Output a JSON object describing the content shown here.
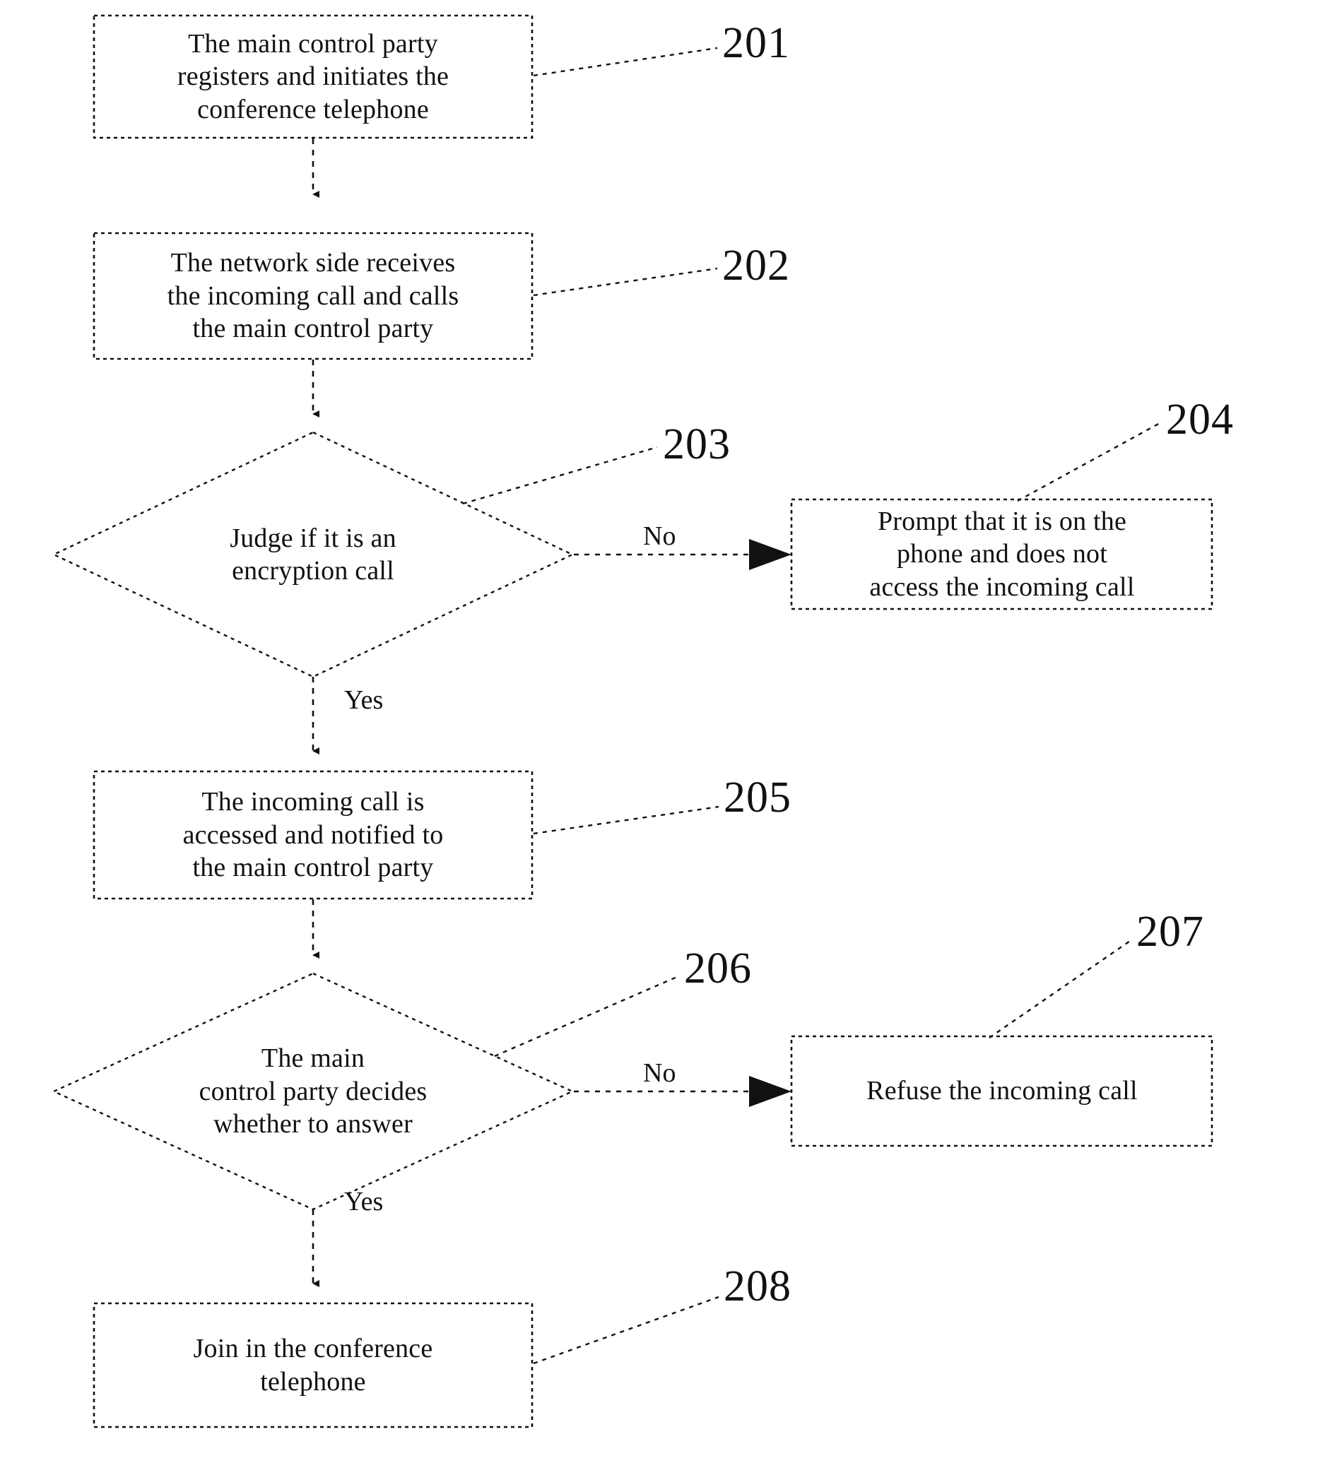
{
  "diagram": {
    "title": "Conference telephone incoming call handling flowchart",
    "type": "flowchart",
    "stroke_color": "#1a1a1a",
    "fill_color": "#ffffff",
    "background_color": "#ffffff"
  },
  "nodes": [
    {
      "id": "201",
      "shape": "process",
      "text": "The main control party\nregisters and initiates the\nconference telephone",
      "ref": "201"
    },
    {
      "id": "202",
      "shape": "process",
      "text": "The network side receives\nthe incoming call and calls\nthe main control party",
      "ref": "202"
    },
    {
      "id": "203",
      "shape": "decision",
      "text": "Judge if it is an\nencryption call",
      "ref": "203"
    },
    {
      "id": "204",
      "shape": "process",
      "text": "Prompt that it is on the\nphone and does not\naccess the incoming call",
      "ref": "204"
    },
    {
      "id": "205",
      "shape": "process",
      "text": "The incoming call is\naccessed and notified to\nthe main control party",
      "ref": "205"
    },
    {
      "id": "206",
      "shape": "decision",
      "text": "The main\ncontrol party decides\nwhether to answer",
      "ref": "206"
    },
    {
      "id": "207",
      "shape": "process",
      "text": "Refuse the incoming call",
      "ref": "207"
    },
    {
      "id": "208",
      "shape": "process",
      "text": "Join in the conference\ntelephone",
      "ref": "208"
    }
  ],
  "edge_labels": {
    "no_203": "No",
    "yes_203": "Yes",
    "no_206": "No",
    "yes_206": "Yes"
  },
  "refs": {
    "r201": "201",
    "r202": "202",
    "r203": "203",
    "r204": "204",
    "r205": "205",
    "r206": "206",
    "r207": "207",
    "r208": "208"
  }
}
